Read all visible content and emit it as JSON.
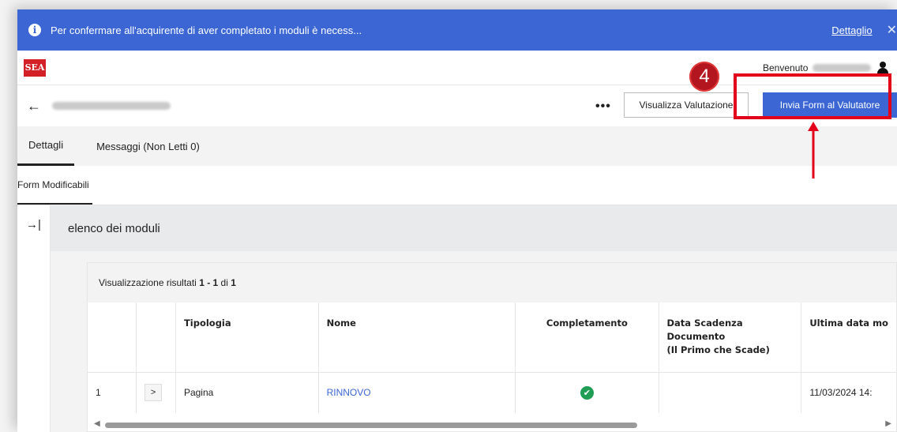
{
  "banner": {
    "message": "Per confermare all'acquirente di aver completato i moduli è necess...",
    "detail_link": "Dettaglio",
    "close_glyph": "✕"
  },
  "topbar": {
    "logo_text": "SEA",
    "welcome_label": "Benvenuto"
  },
  "step_badge": "4",
  "header": {
    "back_glyph": "←",
    "more_glyph": "•••",
    "view_button": "Visualizza Valutazione",
    "send_button": "Invia Form al Valutatore"
  },
  "tabs": [
    {
      "label": "Dettagli",
      "active": true
    },
    {
      "label": "Messaggi (Non Letti 0)",
      "active": false
    }
  ],
  "subtab": "Form Modificabili",
  "side_rail_glyph": "→|",
  "section_title": "elenco dei moduli",
  "results": {
    "prefix": "Visualizzazione risultati",
    "range": "1 - 1",
    "of": "di",
    "total": "1"
  },
  "table": {
    "headers": [
      "",
      "",
      "Tipologia",
      "Nome",
      "Completamento",
      "Data Scadenza Documento (Il Primo che Scade)",
      "Ultima data mo"
    ],
    "header_date_lines": [
      "Data Scadenza",
      "Documento",
      "(Il Primo che Scade)"
    ],
    "rows": [
      {
        "index": "1",
        "expand_glyph": ">",
        "tipologia": "Pagina",
        "nome": "RINNOVO",
        "completamento": "✔",
        "scadenza": "",
        "ultima": "11/03/2024 14:"
      }
    ]
  },
  "colors": {
    "primary": "#3b66d4",
    "highlight": "#e3001b",
    "badge": "#b3161f",
    "success": "#1f9d55"
  }
}
